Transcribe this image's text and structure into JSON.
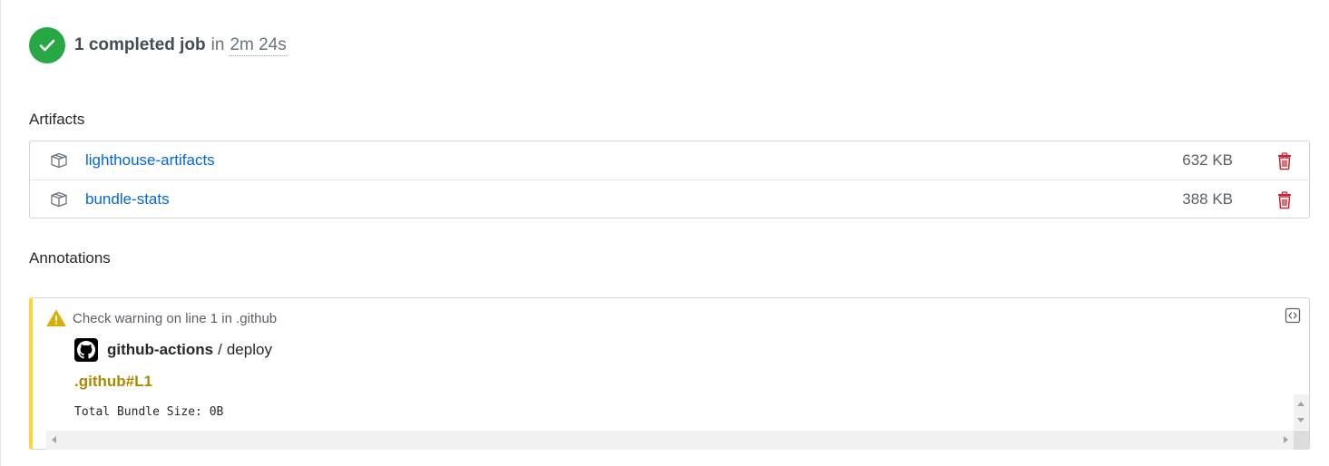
{
  "summary": {
    "jobs_text": "1 completed job",
    "in_text": "in",
    "duration": "2m 24s"
  },
  "artifacts": {
    "title": "Artifacts",
    "items": [
      {
        "name": "lighthouse-artifacts",
        "size": "632 KB"
      },
      {
        "name": "bundle-stats",
        "size": "388 KB"
      }
    ]
  },
  "annotations": {
    "title": "Annotations",
    "items": [
      {
        "level_text": "Check warning on line 1 in .github",
        "actor": "github-actions",
        "separator": "/",
        "job": "deploy",
        "location": ".github#L1",
        "message": "Total Bundle Size: 0B"
      }
    ]
  },
  "icons": {
    "status": "check-icon",
    "artifact": "package-icon",
    "delete": "trash-icon",
    "warning": "warning-icon",
    "raw": "code-square-icon",
    "actor_logo": "github-mark-icon"
  },
  "colors": {
    "success": "#28a745",
    "link": "#0366d6",
    "danger": "#cb2431",
    "warning_bar": "#ffd33d",
    "warning_icon": "#dbab09",
    "location": "#b08800"
  }
}
